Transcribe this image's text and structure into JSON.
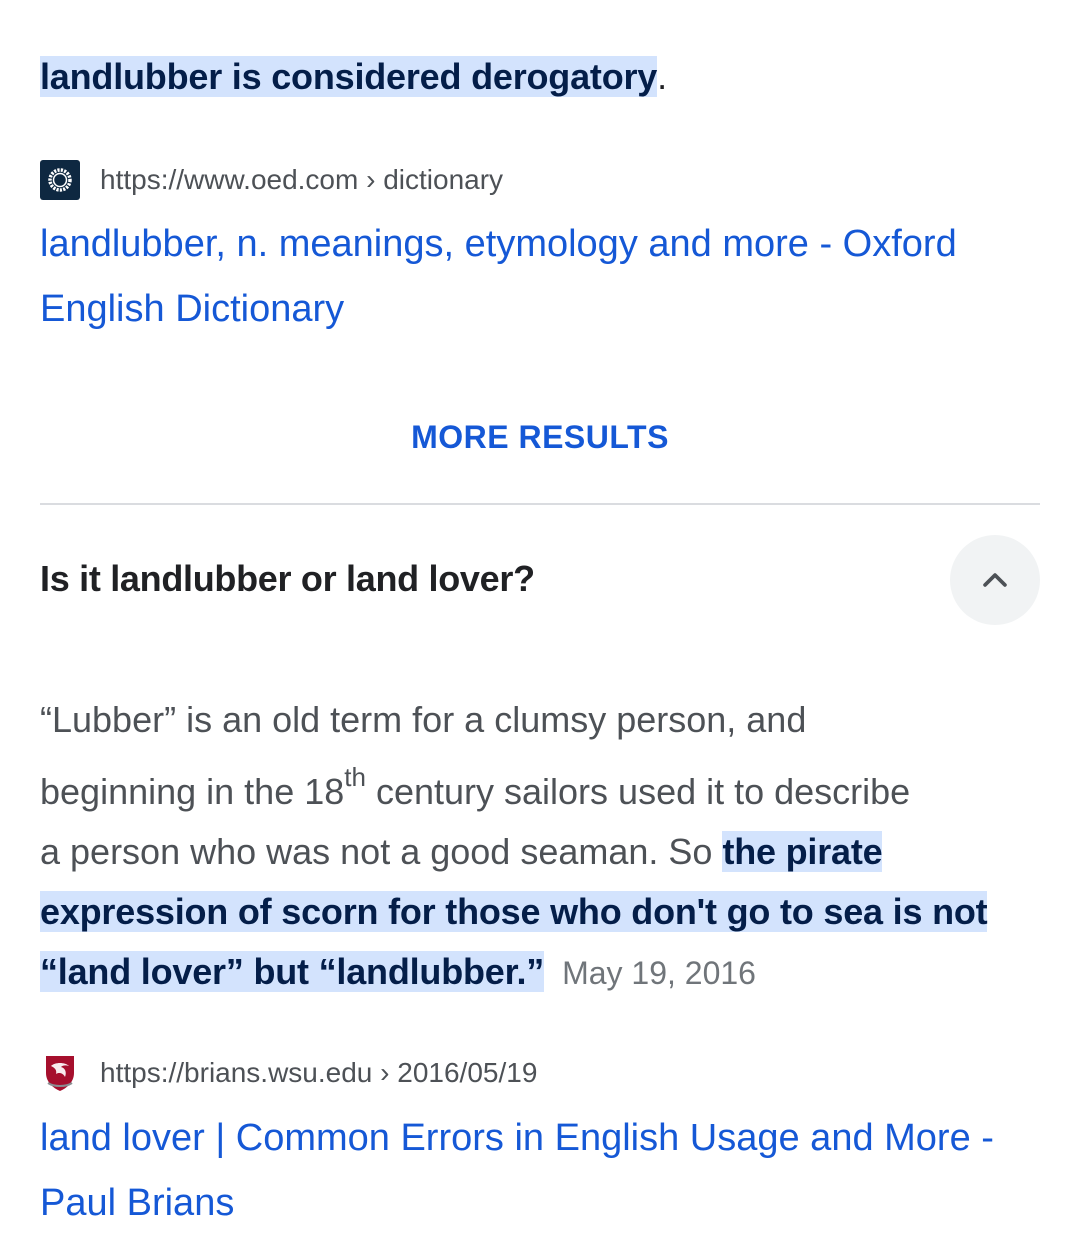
{
  "top_snippet": {
    "highlight": "landlubber is considered derogatory",
    "trailing": "."
  },
  "result1": {
    "cite": "https://www.oed.com › dictionary",
    "title_line1": "landlubber, n. meanings, etymology and more - Oxford",
    "title_line2": "English Dictionary"
  },
  "more_results_label": "MORE RESULTS",
  "faq": {
    "question": "Is it landlubber or land lover?",
    "collapse_icon": "chevron-up-icon",
    "answer": {
      "line1": "“Lubber” is an old term for a clumsy person, and",
      "line2_pre": "beginning in the 18",
      "line2_sup": "th",
      "line2_post": " century sailors used it to describe",
      "line3_pre": "a person who was not a good seaman. So ",
      "highlight_1": "the pirate",
      "highlight_2": "expression of scorn for those who don't go to sea is not",
      "highlight_3": "“land lover” but “landlubber.”",
      "date": "May 19, 2016"
    }
  },
  "result2": {
    "cite": "https://brians.wsu.edu › 2016/05/19",
    "title_line1": "land lover | Common Errors in English Usage and More -",
    "title_line2": "Paul Brians"
  },
  "colors": {
    "link": "#1558d6",
    "highlight_bg": "#d3e3fd",
    "oed_favicon": "#0e2841",
    "wsu_favicon": "#a60f2d"
  }
}
